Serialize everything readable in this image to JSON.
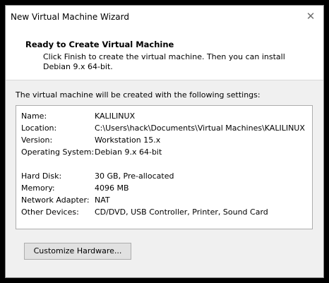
{
  "window": {
    "title": "New Virtual Machine Wizard",
    "close_glyph": "✕"
  },
  "header": {
    "title": "Ready to Create Virtual Machine",
    "description": "Click Finish to create the virtual machine. Then you can install Debian 9.x 64-bit."
  },
  "main": {
    "intro": "The virtual machine will be created with the following settings:",
    "settings": [
      {
        "label": "Name:",
        "value": "KALILINUX"
      },
      {
        "label": "Location:",
        "value": "C:\\Users\\hack\\Documents\\Virtual Machines\\KALILINUX"
      },
      {
        "label": "Version:",
        "value": "Workstation 15.x"
      },
      {
        "label": "Operating System:",
        "value": "Debian 9.x 64-bit"
      },
      {
        "label": "Hard Disk:",
        "value": "30 GB, Pre-allocated"
      },
      {
        "label": "Memory:",
        "value": "4096 MB"
      },
      {
        "label": "Network Adapter:",
        "value": "NAT"
      },
      {
        "label": "Other Devices:",
        "value": "CD/DVD, USB Controller, Printer, Sound Card"
      }
    ],
    "customize_label": "Customize Hardware..."
  }
}
